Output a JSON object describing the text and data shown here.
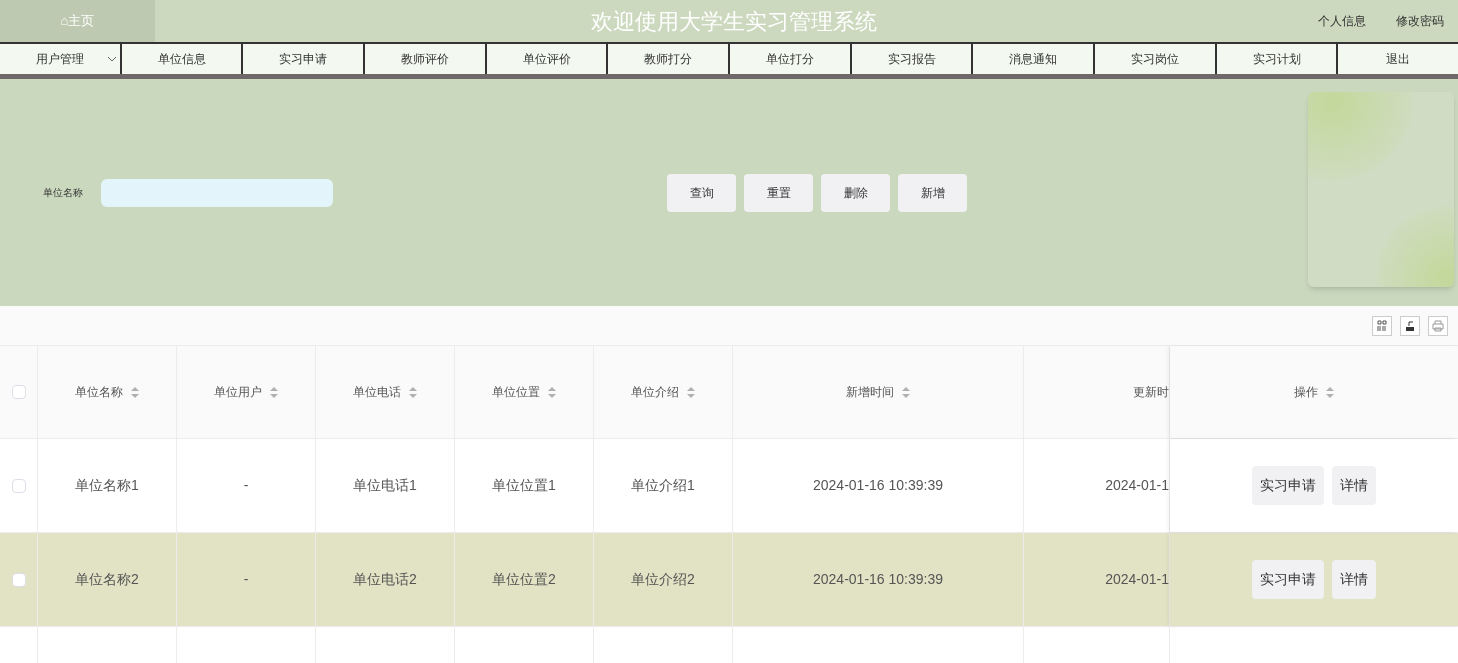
{
  "header": {
    "home": "⌂主页",
    "title": "欢迎使用大学生实习管理系统",
    "links": [
      "个人信息",
      "修改密码"
    ]
  },
  "nav": [
    {
      "label": "用户管理",
      "dropdown": true
    },
    {
      "label": "单位信息",
      "dropdown": false
    },
    {
      "label": "实习申请",
      "dropdown": false
    },
    {
      "label": "教师评价",
      "dropdown": false
    },
    {
      "label": "单位评价",
      "dropdown": false
    },
    {
      "label": "教师打分",
      "dropdown": false
    },
    {
      "label": "单位打分",
      "dropdown": false
    },
    {
      "label": "实习报告",
      "dropdown": false
    },
    {
      "label": "消息通知",
      "dropdown": false
    },
    {
      "label": "实习岗位",
      "dropdown": false
    },
    {
      "label": "实习计划",
      "dropdown": false
    },
    {
      "label": "退出",
      "dropdown": false
    }
  ],
  "search": {
    "label": "单位名称",
    "buttons": [
      "查询",
      "重置",
      "删除",
      "新增"
    ]
  },
  "table": {
    "all_checked": false,
    "columns": [
      "单位名称",
      "单位用户",
      "单位电话",
      "单位位置",
      "单位介绍",
      "新增时间",
      "更新时",
      "操作"
    ],
    "rows": [
      {
        "checked": false,
        "selected": false,
        "cells": [
          "单位名称1",
          "-",
          "单位电话1",
          "单位位置1",
          "单位介绍1",
          "2024-01-16 10:39:39",
          "2024-01-1"
        ],
        "actions": [
          "实习申请",
          "详情"
        ]
      },
      {
        "checked": false,
        "selected": true,
        "cells": [
          "单位名称2",
          "-",
          "单位电话2",
          "单位位置2",
          "单位介绍2",
          "2024-01-16 10:39:39",
          "2024-01-1"
        ],
        "actions": [
          "实习申请",
          "详情"
        ]
      }
    ]
  }
}
